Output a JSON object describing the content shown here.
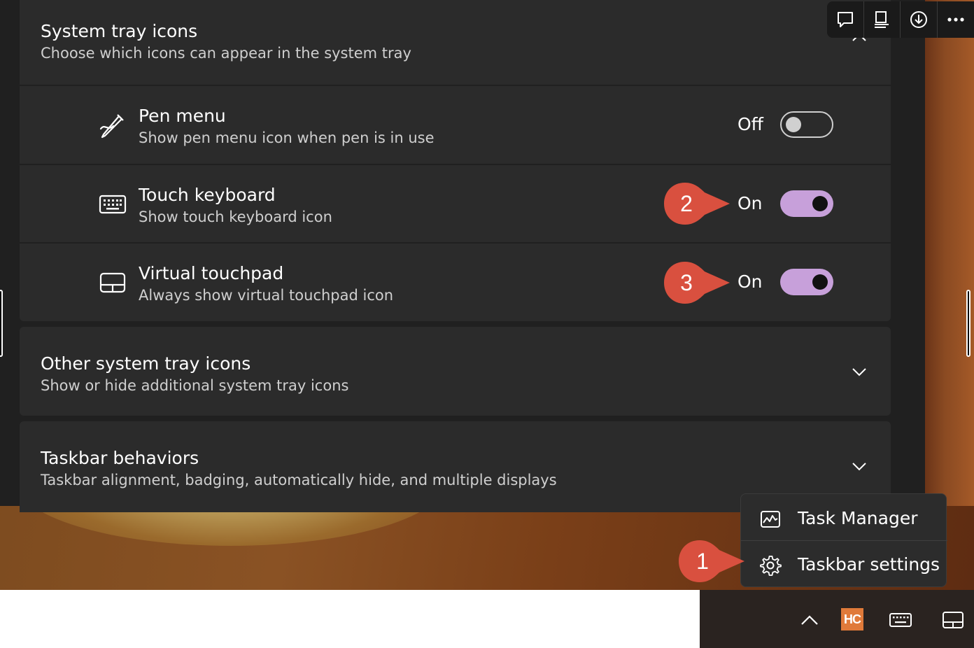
{
  "sections": {
    "system_tray": {
      "title": "System tray icons",
      "subtitle": "Choose which icons can appear in the system tray",
      "items": [
        {
          "title": "Pen menu",
          "subtitle": "Show pen menu icon when pen is in use",
          "state": "Off"
        },
        {
          "title": "Touch keyboard",
          "subtitle": "Show touch keyboard icon",
          "state": "On"
        },
        {
          "title": "Virtual touchpad",
          "subtitle": "Always show virtual touchpad icon",
          "state": "On"
        }
      ]
    },
    "other_tray": {
      "title": "Other system tray icons",
      "subtitle": "Show or hide additional system tray icons"
    },
    "behaviors": {
      "title": "Taskbar behaviors",
      "subtitle": "Taskbar alignment, badging, automatically hide, and multiple displays"
    }
  },
  "callouts": [
    "1",
    "2",
    "3"
  ],
  "context_menu": {
    "items": [
      {
        "label": "Task Manager",
        "icon": "task-manager-icon"
      },
      {
        "label": "Taskbar settings",
        "icon": "gear-icon"
      }
    ]
  },
  "taskbar": {
    "app_badge": "HC"
  },
  "colors": {
    "accent": "#c7a0da",
    "callout": "#d9503f",
    "panel": "#2b2b2b",
    "background": "#202020"
  }
}
